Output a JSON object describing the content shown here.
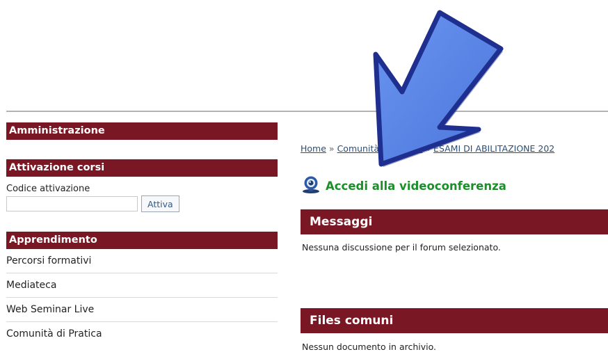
{
  "sidebar": {
    "admin_title": "Amministrazione",
    "activation": {
      "title": "Attivazione corsi",
      "code_label": "Codice attivazione",
      "code_value": "",
      "button_label": "Attiva"
    },
    "learning": {
      "title": "Apprendimento",
      "items": [
        {
          "label": "Percorsi formativi"
        },
        {
          "label": "Mediateca"
        },
        {
          "label": "Web Seminar Live"
        },
        {
          "label": "Comunità di Pratica"
        }
      ]
    }
  },
  "main": {
    "breadcrumb": {
      "home": "Home",
      "separator": "»",
      "community": "Comunità di Pratica",
      "current": "ESAMI DI ABILITAZIONE 202"
    },
    "video_link": "Accedi alla videoconferenza",
    "messages": {
      "title": "Messaggi",
      "empty_text": "Nessuna discussione per il forum selezionato."
    },
    "files": {
      "title": "Files comuni",
      "empty_text": "Nessun documento in archivio."
    }
  },
  "colors": {
    "header_bg": "#7a1724",
    "link_green": "#1c8f2a",
    "arrow_fill": "#5a86e6"
  },
  "icons": [
    "webcam-icon",
    "annotation-arrow"
  ]
}
